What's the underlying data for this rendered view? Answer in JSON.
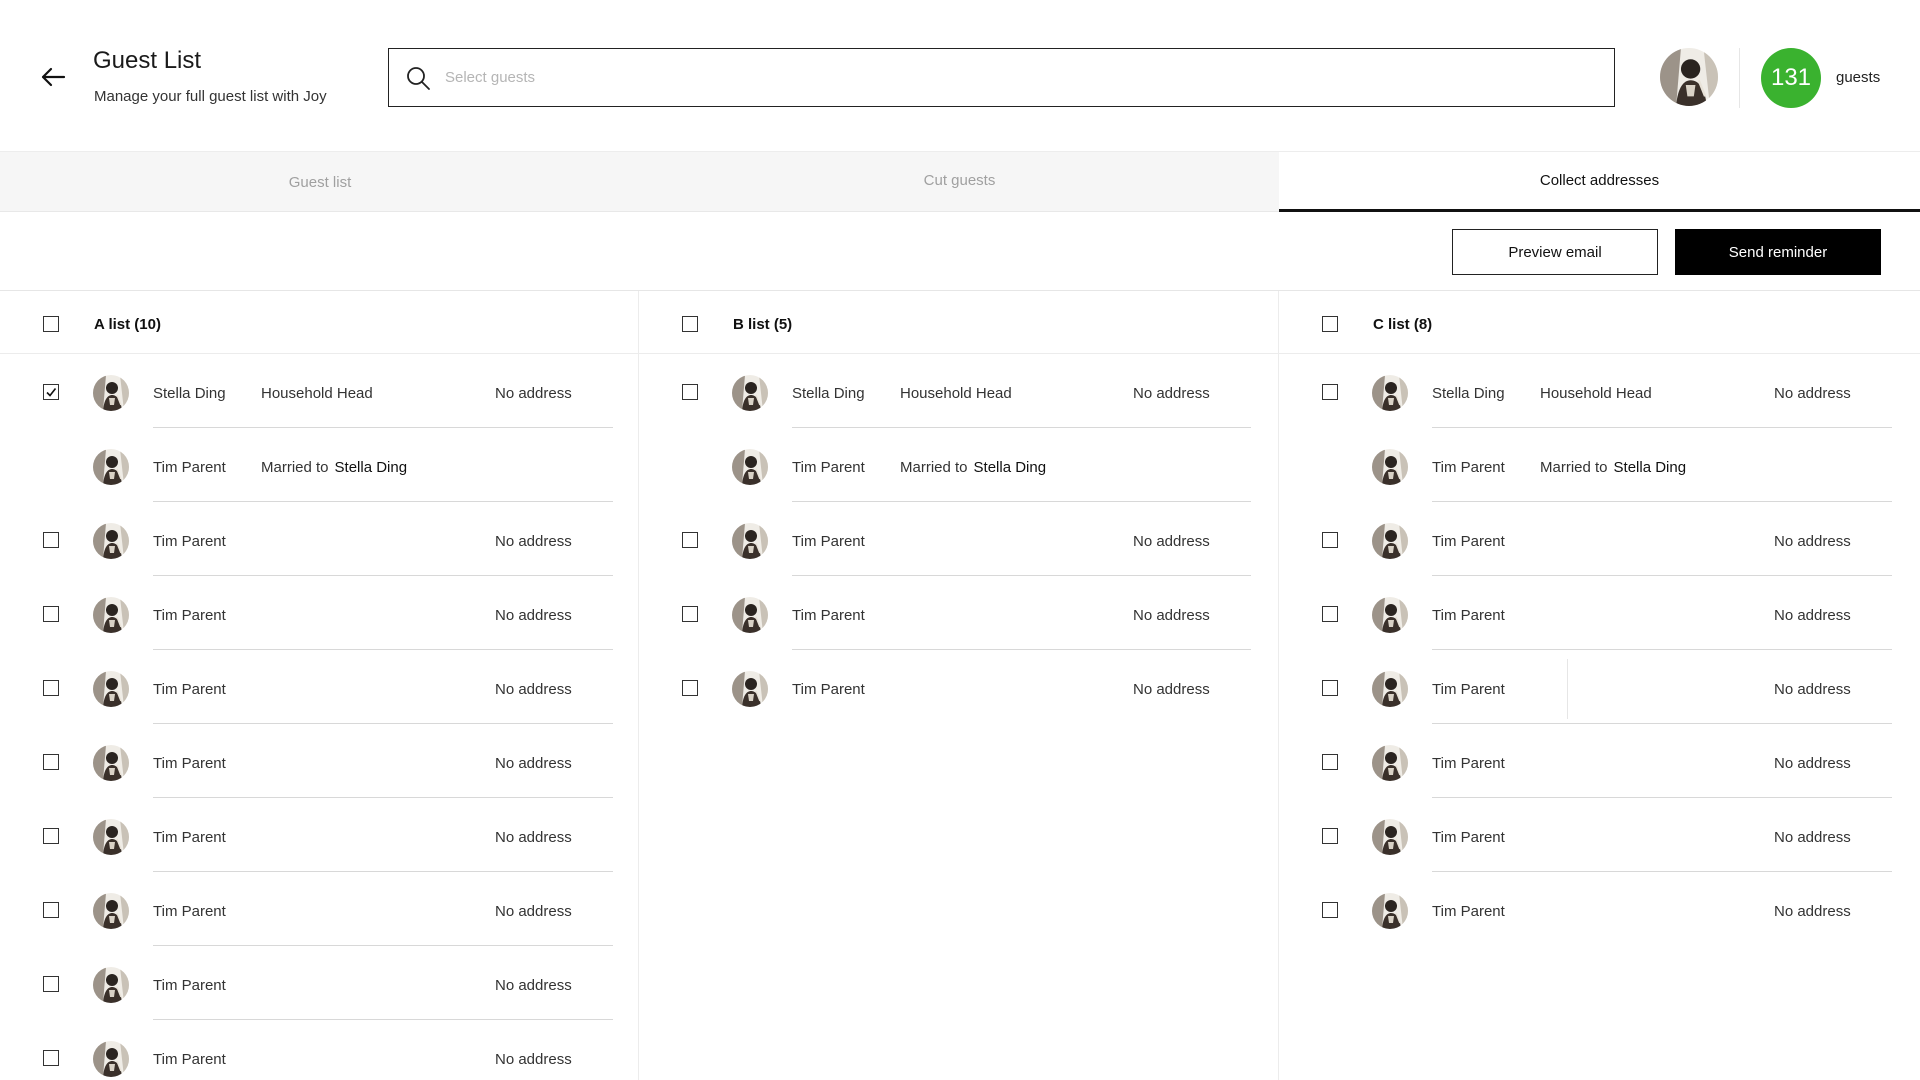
{
  "header": {
    "title": "Guest List",
    "subtitle": "Manage your full guest list with Joy",
    "search_placeholder": "Select guests",
    "guest_count": "131",
    "guest_count_label": "guests"
  },
  "tabs": [
    {
      "label": "Guest list",
      "active": false
    },
    {
      "label": "Cut guests",
      "active": false
    },
    {
      "label": "Collect addresses",
      "active": true
    }
  ],
  "actions": {
    "preview_label": "Preview email",
    "send_label": "Send reminder"
  },
  "lists": [
    {
      "title": "A list (10)",
      "guests": [
        {
          "name": "Stella Ding",
          "role": "Household Head",
          "address": "No address",
          "checked": true,
          "has_checkbox": true
        },
        {
          "name": "Tim Parent",
          "role": "Married to",
          "spouse": "Stella Ding",
          "address": "",
          "checked": false,
          "has_checkbox": false
        },
        {
          "name": "Tim Parent",
          "address": "No address",
          "checked": false,
          "has_checkbox": true
        },
        {
          "name": "Tim Parent",
          "address": "No address",
          "checked": false,
          "has_checkbox": true
        },
        {
          "name": "Tim Parent",
          "address": "No address",
          "checked": false,
          "has_checkbox": true
        },
        {
          "name": "Tim Parent",
          "address": "No address",
          "checked": false,
          "has_checkbox": true
        },
        {
          "name": "Tim Parent",
          "address": "No address",
          "checked": false,
          "has_checkbox": true
        },
        {
          "name": "Tim Parent",
          "address": "No address",
          "checked": false,
          "has_checkbox": true
        },
        {
          "name": "Tim Parent",
          "address": "No address",
          "checked": false,
          "has_checkbox": true
        },
        {
          "name": "Tim Parent",
          "address": "No address",
          "checked": false,
          "has_checkbox": true
        }
      ]
    },
    {
      "title": "B list (5)",
      "guests": [
        {
          "name": "Stella Ding",
          "role": "Household Head",
          "address": "No address",
          "checked": false,
          "has_checkbox": true
        },
        {
          "name": "Tim Parent",
          "role": "Married to",
          "spouse": "Stella Ding",
          "address": "",
          "checked": false,
          "has_checkbox": false
        },
        {
          "name": "Tim Parent",
          "address": "No address",
          "checked": false,
          "has_checkbox": true
        },
        {
          "name": "Tim Parent",
          "address": "No address",
          "checked": false,
          "has_checkbox": true
        },
        {
          "name": "Tim Parent",
          "address": "No address",
          "checked": false,
          "has_checkbox": true
        }
      ]
    },
    {
      "title": "C list (8)",
      "guests": [
        {
          "name": "Stella Ding",
          "role": "Household Head",
          "address": "No address",
          "checked": false,
          "has_checkbox": true
        },
        {
          "name": "Tim Parent",
          "role": "Married to",
          "spouse": "Stella Ding",
          "address": "",
          "checked": false,
          "has_checkbox": false
        },
        {
          "name": "Tim Parent",
          "address": "No address",
          "checked": false,
          "has_checkbox": true
        },
        {
          "name": "Tim Parent",
          "address": "No address",
          "checked": false,
          "has_checkbox": true
        },
        {
          "name": "Tim Parent",
          "address": "No address",
          "checked": false,
          "has_checkbox": true
        },
        {
          "name": "Tim Parent",
          "address": "No address",
          "checked": false,
          "has_checkbox": true
        },
        {
          "name": "Tim Parent",
          "address": "No address",
          "checked": false,
          "has_checkbox": true
        },
        {
          "name": "Tim Parent",
          "address": "No address",
          "checked": false,
          "has_checkbox": true
        }
      ]
    }
  ],
  "colors": {
    "accent_green": "#3ab22f",
    "primary_black": "#000000",
    "tab_bg": "#f6f6f6"
  },
  "icons": {
    "back": "arrow-left-icon",
    "search": "search-icon",
    "check": "checkmark-icon"
  }
}
